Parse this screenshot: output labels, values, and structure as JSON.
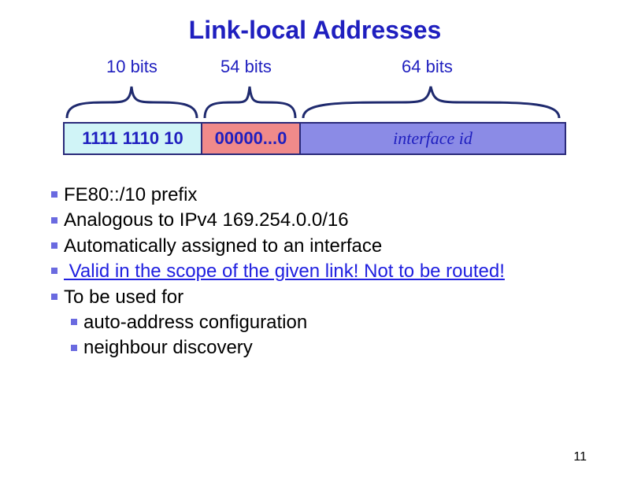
{
  "title": "Link-local Addresses",
  "bits": {
    "label1": "10 bits",
    "label2": "54 bits",
    "label3": "64 bits"
  },
  "fields": {
    "f1": "1111 1110 10",
    "f2": "00000...0",
    "f3": "interface id"
  },
  "bullets": {
    "b1": "FE80::/10 prefix",
    "b2": "Analogous to IPv4 169.254.0.0/16",
    "b3": "Automatically assigned to an interface",
    "b4": " Valid in the scope of the given link! Not to be routed!",
    "b5": "To be used for",
    "s1": "auto-address configuration",
    "s2": "neighbour discovery"
  },
  "page": "11"
}
